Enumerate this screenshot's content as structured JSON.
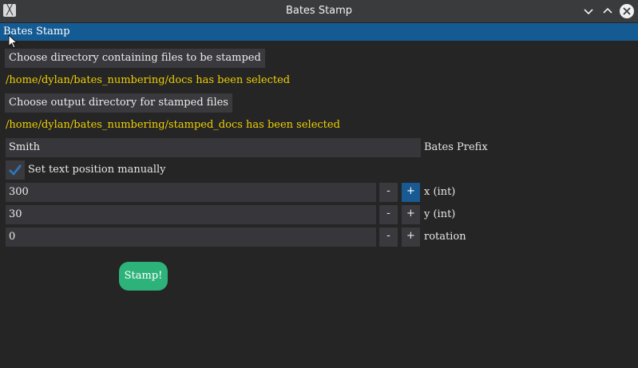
{
  "window": {
    "title": "Bates Stamp",
    "app_icon": "x11-app-icon",
    "controls": [
      "minimize-icon",
      "maximize-icon",
      "close-icon"
    ]
  },
  "menu": {
    "title": "Bates Stamp"
  },
  "input_dir": {
    "button_label": "Choose directory containing files to be stamped",
    "status": "/home/dylan/bates_numbering/docs has been selected"
  },
  "output_dir": {
    "button_label": "Choose output directory for stamped files",
    "status": "/home/dylan/bates_numbering/stamped_docs has been selected"
  },
  "prefix": {
    "value": "Smith",
    "label": "Bates Prefix"
  },
  "manual_position": {
    "checked": true,
    "label": "Set text position manually"
  },
  "x": {
    "value": "300",
    "label": "x (int)",
    "minus": "-",
    "plus": "+"
  },
  "y": {
    "value": "30",
    "label": "y (int)",
    "minus": "-",
    "plus": "+"
  },
  "rotation": {
    "value": "0",
    "label": "rotation",
    "minus": "-",
    "plus": "+"
  },
  "stamp_button": {
    "label": "Stamp!"
  },
  "colors": {
    "background": "#252526",
    "accent": "#155b93",
    "status_text": "#f0d000",
    "stamp_button": "#2db37a"
  }
}
